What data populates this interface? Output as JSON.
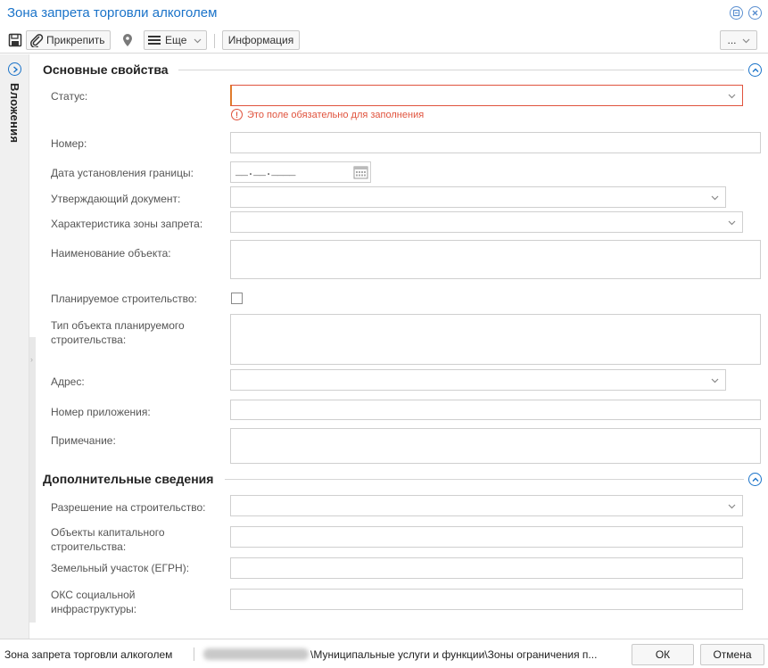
{
  "window": {
    "title": "Зона запрета торговли алкоголем"
  },
  "toolbar": {
    "pin_label": "Прикрепить",
    "more_label": "Еще",
    "info_label": "Информация",
    "overflow_label": "..."
  },
  "side_panel": {
    "label": "Вложения"
  },
  "main_section": {
    "title": "Основные свойства",
    "error_message": "Это поле обязательно для заполнения",
    "fields": {
      "status": {
        "label": "Статус:",
        "value": ""
      },
      "number": {
        "label": "Номер:",
        "value": ""
      },
      "boundary_date": {
        "label": "Дата установления границы:",
        "value": "__.__.____"
      },
      "approving_doc": {
        "label": "Утверждающий документ:",
        "value": ""
      },
      "zone_characteristic": {
        "label": "Характеристика зоны запрета:",
        "value": ""
      },
      "object_name": {
        "label": "Наименование объекта:",
        "value": ""
      },
      "planned_construction": {
        "label": "Планируемое строительство:",
        "checked": false
      },
      "planned_object_type": {
        "label": "Тип объекта планируемого строительства:",
        "value": ""
      },
      "address": {
        "label": "Адрес:",
        "value": ""
      },
      "attachment_number": {
        "label": "Номер приложения:",
        "value": ""
      },
      "note": {
        "label": "Примечание:",
        "value": ""
      }
    }
  },
  "extra_section": {
    "title": "Дополнительные сведения",
    "fields": {
      "building_permit": {
        "label": "Разрешение на строительство:",
        "value": ""
      },
      "capital_objects": {
        "label": "Объекты капитального строительства:",
        "value": ""
      },
      "land_plot": {
        "label": "Земельный участок (ЕГРН):",
        "value": ""
      },
      "social_infra": {
        "label": "ОКС социальной инфраструктуры:",
        "value": ""
      }
    }
  },
  "statusbar": {
    "doc_title": "Зона запрета торговли алкоголем",
    "path": "\\Муниципальные услуги и функции\\Зоны ограничения п...",
    "ok_label": "ОК",
    "cancel_label": "Отмена"
  },
  "colors": {
    "accent": "#1a73c9",
    "error": "#e0533d",
    "error_left": "#e07b2c",
    "field_border": "#cfcfcf"
  },
  "icons": {
    "save": "floppy-disk-icon",
    "pin": "paperclip-icon",
    "location": "map-pin-icon",
    "menu": "hamburger-icon",
    "chevron": "chevron-down-icon",
    "calendar": "calendar-icon",
    "collapse": "chevron-up-circle-icon",
    "expand_side": "chevron-right-circle-icon",
    "error": "exclamation-circle-icon"
  }
}
